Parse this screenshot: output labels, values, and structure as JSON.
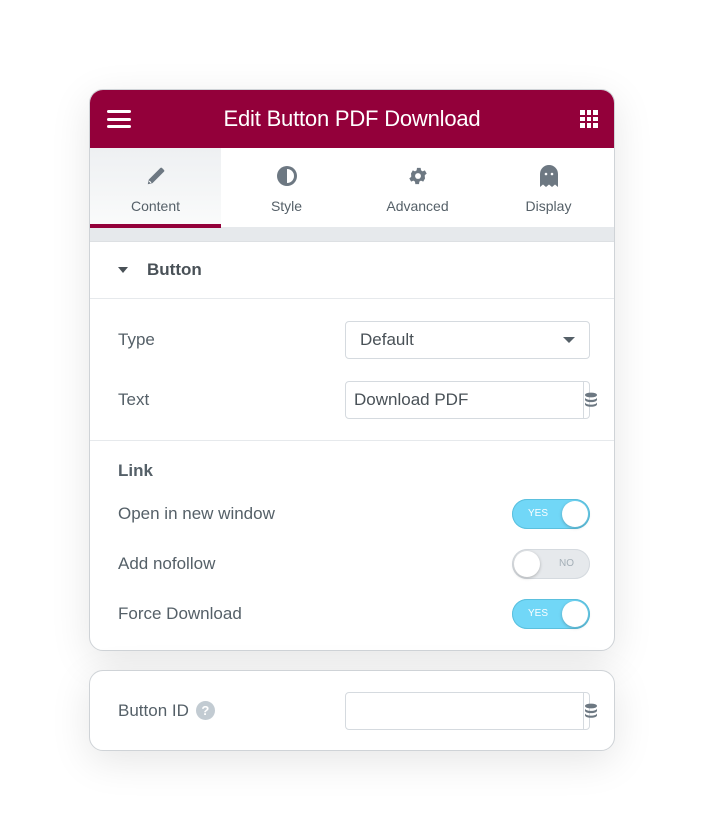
{
  "header": {
    "title": "Edit Button PDF Download",
    "menu_icon": "hamburger-icon",
    "apps_icon": "grid-icon"
  },
  "tabs": [
    {
      "label": "Content",
      "icon": "pencil-icon",
      "active": true
    },
    {
      "label": "Style",
      "icon": "half-circle-icon",
      "active": false
    },
    {
      "label": "Advanced",
      "icon": "gear-icon",
      "active": false
    },
    {
      "label": "Display",
      "icon": "ghost-icon",
      "active": false
    }
  ],
  "section": {
    "title": "Button",
    "type_label": "Type",
    "type_value": "Default",
    "text_label": "Text",
    "text_value": "Download PDF"
  },
  "link": {
    "heading": "Link",
    "toggles": [
      {
        "label": "Open in new window",
        "state": "YES",
        "on": true
      },
      {
        "label": "Add nofollow",
        "state": "NO",
        "on": false
      },
      {
        "label": "Force Download",
        "state": "YES",
        "on": true
      }
    ]
  },
  "button_id": {
    "label": "Button ID",
    "value": "",
    "help_glyph": "?"
  },
  "colors": {
    "brand": "#93003a",
    "toggle_on": "#71d7f7",
    "toggle_off": "#e6e9ec",
    "text": "#556068"
  }
}
